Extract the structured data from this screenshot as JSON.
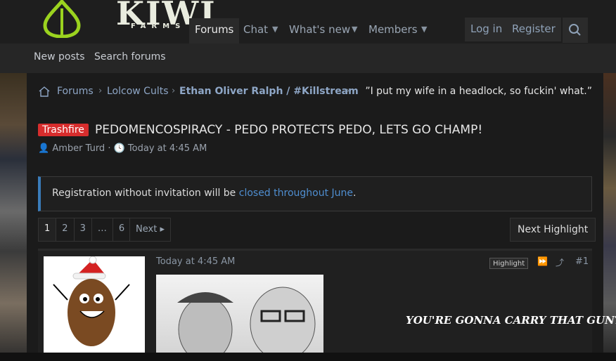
{
  "header": {
    "logo_text": "KIWI",
    "logo_sub": "FARMS",
    "nav": [
      "Forums",
      "Chat",
      "What's new",
      "Members"
    ],
    "login": "Log in",
    "register": "Register"
  },
  "subnav": [
    "New posts",
    "Search forums"
  ],
  "breadcrumb": {
    "items": [
      "Forums",
      "Lolcow Cults",
      "Ethan Oliver Ralph / #Killstream"
    ],
    "quote": "”I put my wife in a headlock, so fuckin' what.”"
  },
  "thread": {
    "prefix": "Trashfire",
    "title": "PEDOMENCOSPIRACY - PEDO PROTECTS PEDO, LETS GO CHAMP!",
    "author": "Amber Turd",
    "date": "Today at 4:45 AM"
  },
  "notice": {
    "before": "Registration without invitation will be ",
    "link": "closed throughout June",
    "after": "."
  },
  "pager": {
    "pages": [
      "1",
      "2",
      "3",
      "…",
      "6"
    ],
    "next": "Next",
    "next_highlight": "Next Highlight"
  },
  "post": {
    "date": "Today at 4:45 AM",
    "highlight": "Highlight",
    "number": "#1",
    "caption": "YOU'RE GONNA CARRY THAT GUNT"
  },
  "colors": {
    "prefix": "#d72d2d",
    "link": "#4f8ed0",
    "accent": "#3a7cba"
  }
}
